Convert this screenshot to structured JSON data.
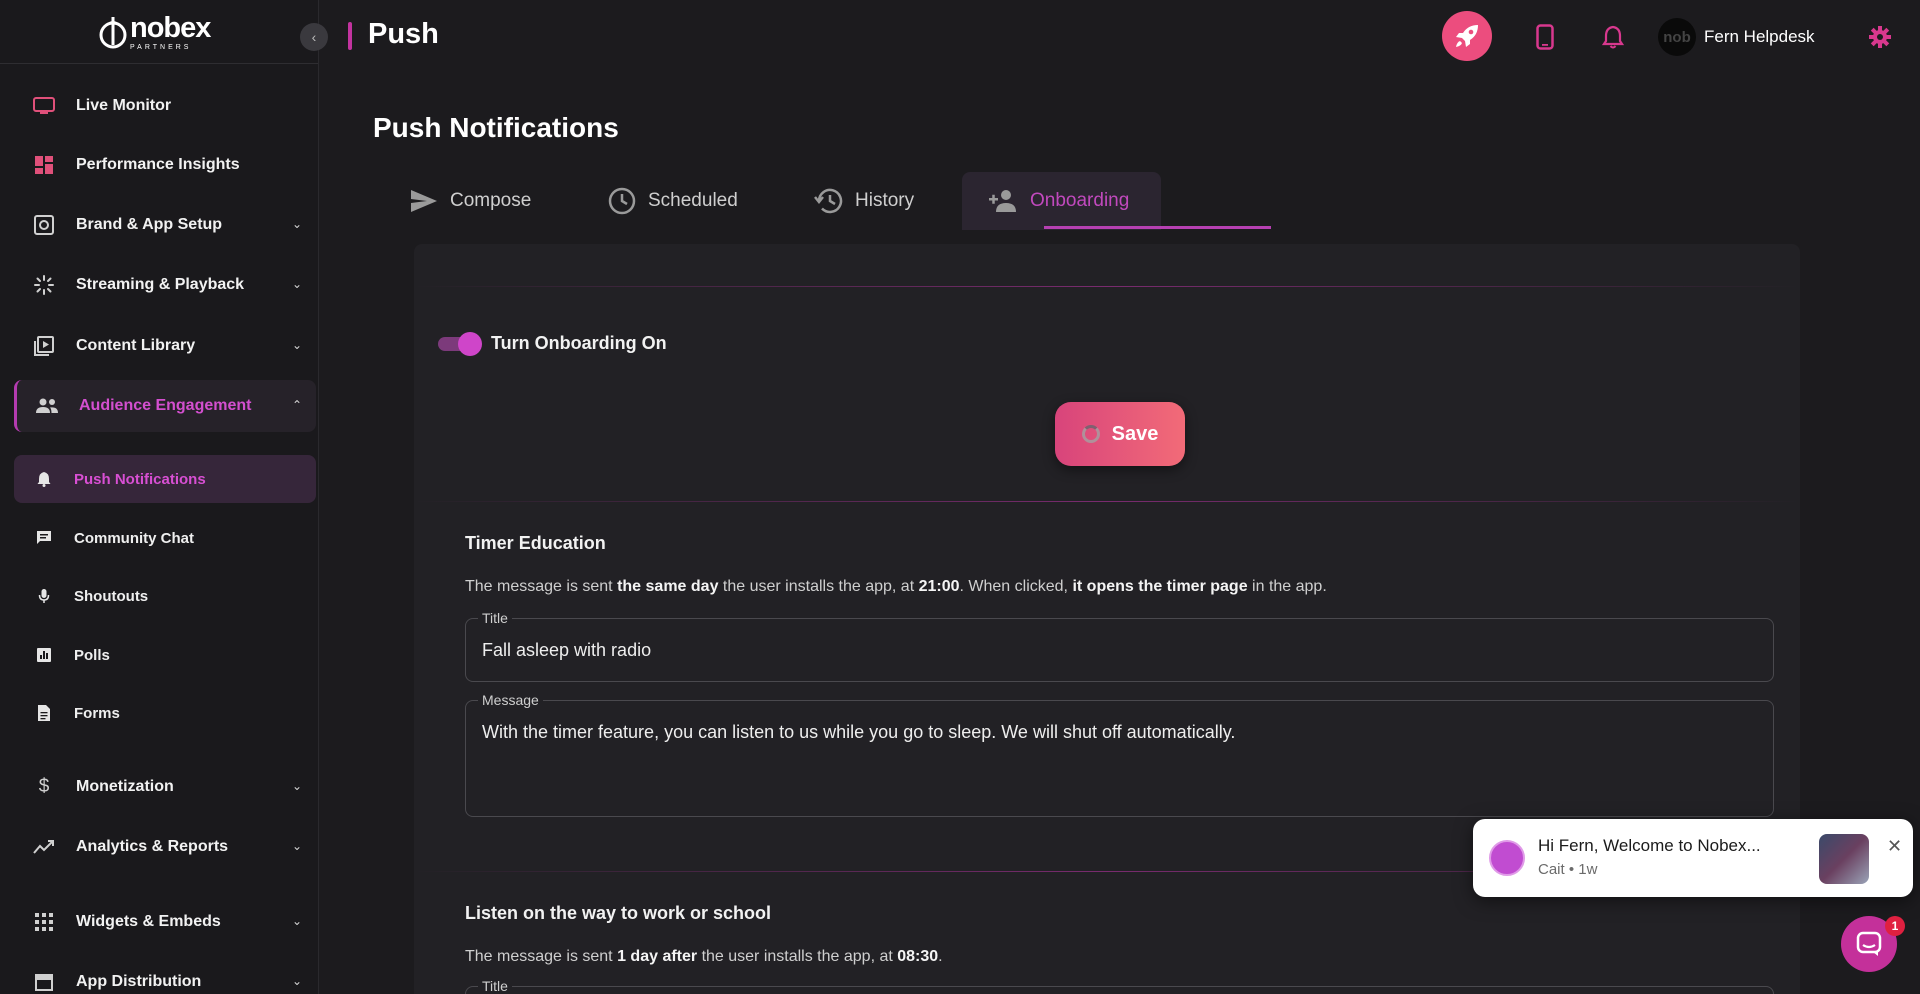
{
  "brand": {
    "logo_main": "nobex",
    "logo_sub": "PARTNERS",
    "accent": "#c2339f"
  },
  "header": {
    "title": "Push",
    "user_name": "Fern Helpdesk",
    "avatar_text": "nob"
  },
  "sidebar": {
    "items": [
      {
        "label": "Live Monitor",
        "icon": "monitor-icon"
      },
      {
        "label": "Performance Insights",
        "icon": "dashboard-icon"
      },
      {
        "label": "Brand & App Setup",
        "icon": "settings-box-icon"
      },
      {
        "label": "Streaming & Playback",
        "icon": "loading-icon"
      },
      {
        "label": "Content Library",
        "icon": "video-library-icon"
      },
      {
        "label": "Audience Engagement",
        "icon": "people-icon"
      },
      {
        "label": "Monetization",
        "icon": "dollar-icon"
      },
      {
        "label": "Analytics & Reports",
        "icon": "trend-icon"
      },
      {
        "label": "Widgets & Embeds",
        "icon": "grid-icon"
      },
      {
        "label": "App Distribution",
        "icon": "store-icon"
      }
    ],
    "sub_items": [
      {
        "label": "Push Notifications",
        "icon": "bell-icon"
      },
      {
        "label": "Community Chat",
        "icon": "chat-icon"
      },
      {
        "label": "Shoutouts",
        "icon": "mic-icon"
      },
      {
        "label": "Polls",
        "icon": "poll-icon"
      },
      {
        "label": "Forms",
        "icon": "document-icon"
      }
    ]
  },
  "main": {
    "page_title": "Push Notifications",
    "tabs": [
      {
        "label": "Compose",
        "icon": "send-icon"
      },
      {
        "label": "Scheduled",
        "icon": "clock-icon"
      },
      {
        "label": "History",
        "icon": "history-icon"
      },
      {
        "label": "Onboarding",
        "icon": "person-add-icon"
      }
    ],
    "toggle_label": "Turn Onboarding On",
    "save_label": "Save",
    "sections": [
      {
        "title": "Timer Education",
        "desc": {
          "p1": "The message is sent ",
          "b1": "the same day",
          "p2": " the user installs the app, at ",
          "b2": "21:00",
          "p3": ". When clicked, ",
          "b3": "it opens the timer page",
          "p4": " in the app."
        },
        "title_label": "Title",
        "title_value": "Fall asleep with radio",
        "message_label": "Message",
        "message_value": "With the timer feature, you can listen to us while you go to sleep. We will shut off automatically."
      },
      {
        "title": "Listen on the way to work or school",
        "desc": {
          "p1": "The message is sent ",
          "b1": "1 day after",
          "p2": " the user installs the app, at ",
          "b2": "08:30",
          "p3": "."
        },
        "title_label": "Title"
      }
    ]
  },
  "chat": {
    "message": "Hi Fern, Welcome to Nobex...",
    "meta": "Cait • 1w",
    "badge": "1"
  }
}
